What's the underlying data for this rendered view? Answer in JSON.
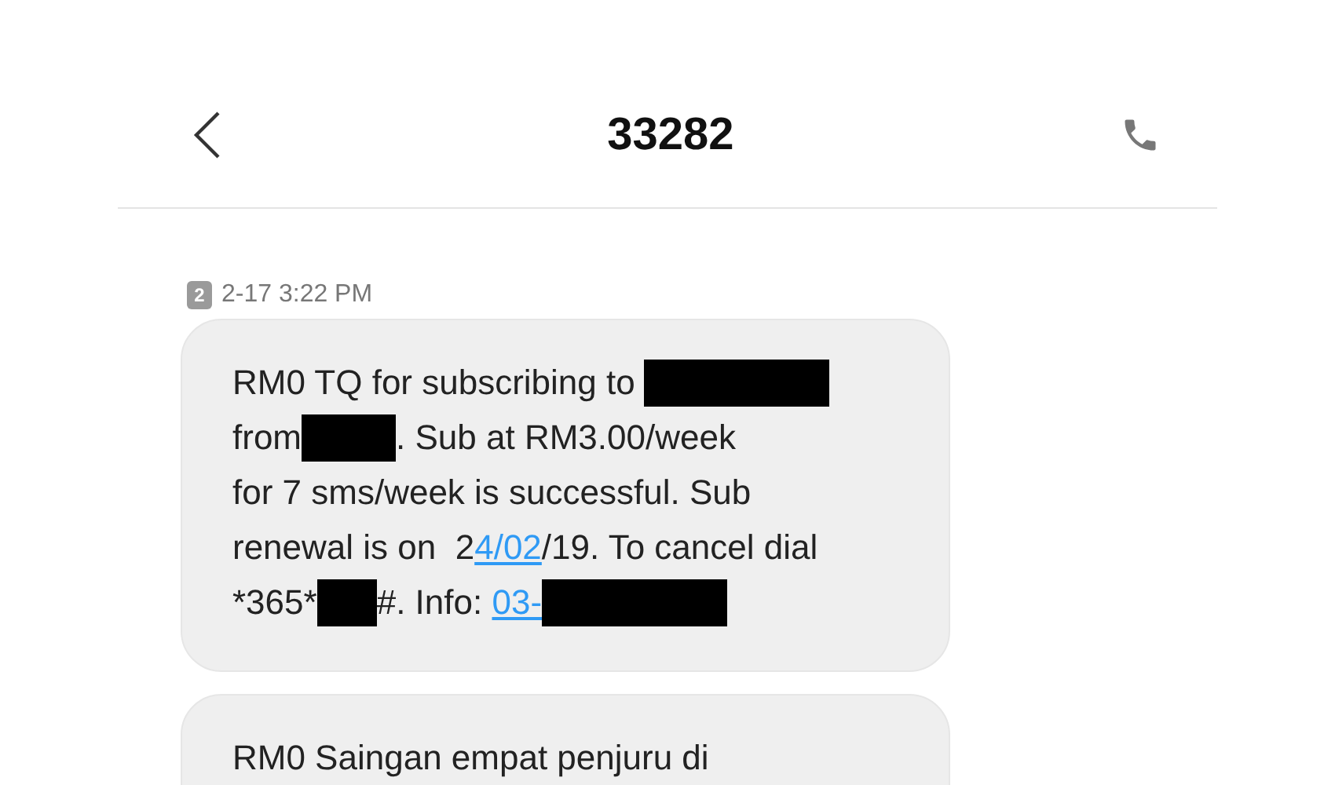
{
  "header": {
    "title": "33282"
  },
  "messages": [
    {
      "sim": "2",
      "time": "2-17 3:22 PM",
      "lines": [
        [
          {
            "kind": "text",
            "text": "RM0 TQ for subscribing to "
          },
          {
            "kind": "redactionwide"
          }
        ],
        [
          {
            "kind": "text",
            "text": "from"
          },
          {
            "kind": "redactionmid"
          },
          {
            "kind": "text",
            "text": ". Sub at RM3.00/week"
          }
        ],
        [
          {
            "kind": "text",
            "text": "for 7 sms/week is successful. Sub"
          }
        ],
        [
          {
            "kind": "text",
            "text": "renewal is on  2"
          },
          {
            "kind": "link",
            "text": "4/02"
          },
          {
            "kind": "text",
            "text": "/19. To cancel dial"
          }
        ],
        [
          {
            "kind": "text",
            "text": "*365*"
          },
          {
            "kind": "redactionnarrow"
          },
          {
            "kind": "text",
            "text": "#. Info: "
          },
          {
            "kind": "link",
            "text": "03-"
          },
          {
            "kind": "redactionwide"
          }
        ]
      ]
    },
    {
      "lines": [
        [
          {
            "kind": "text",
            "text": "RM0 Saingan empat penjuru di"
          }
        ]
      ]
    }
  ]
}
